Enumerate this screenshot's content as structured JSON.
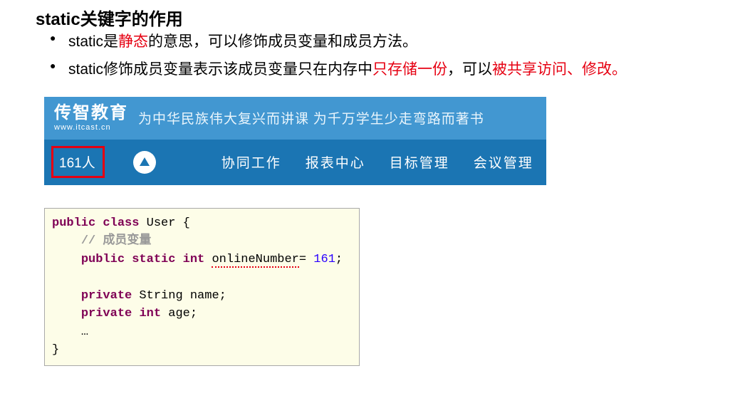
{
  "title": "static关键字的作用",
  "bullets": {
    "b1": {
      "p1": "static是",
      "r1": "静态",
      "p2": "的意思，可以修饰成员变量和成员方法。"
    },
    "b2": {
      "p1": "static修饰成员变量表示该成员变量只在内存中",
      "r1": "只存储一份",
      "p2": "，可以",
      "r2": "被共享访问、修改。"
    }
  },
  "banner": {
    "logo_cn": "传智教育",
    "logo_en": "www.itcast.cn",
    "slogan": "为中华民族伟大复兴而讲课 为千万学生少走弯路而著书",
    "count": "161人",
    "nav1": "协同工作",
    "nav2": "报表中心",
    "nav3": "目标管理",
    "nav4": "会议管理"
  },
  "code": {
    "kw_public": "public",
    "kw_class": "class",
    "cls": " User {",
    "comment": "// 成员变量",
    "kw_static": "static",
    "kw_int": "int",
    "field1_name": "onlineNumber",
    "field1_eq": "= ",
    "field1_val": "161",
    "semi": ";",
    "kw_private": "private",
    "ty_string": " String ",
    "name_field": "name;",
    "age_field": " age;",
    "ellipsis": "…",
    "close": "}"
  }
}
